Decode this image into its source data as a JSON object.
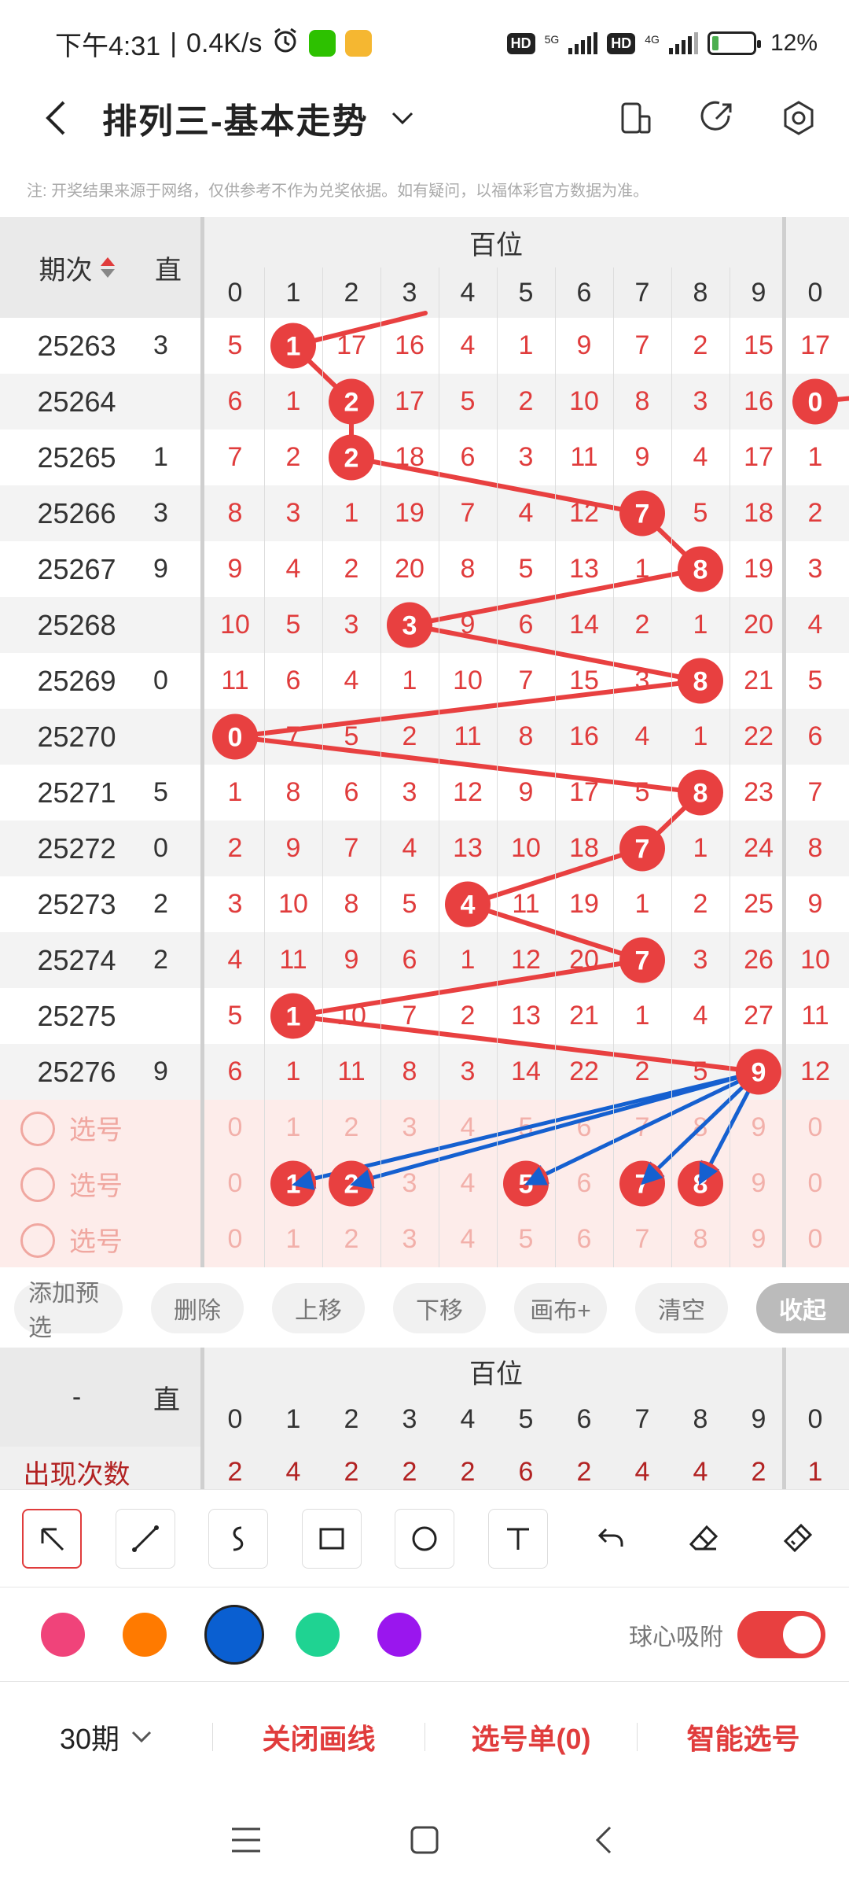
{
  "status": {
    "time": "下午4:31",
    "speed": "0.4K/s",
    "hd1": "HD",
    "net1": "5G",
    "hd2": "HD",
    "net2": "4G",
    "battery": "12%"
  },
  "header": {
    "title": "排列三-基本走势",
    "icons": [
      "back-icon",
      "dropdown-chevron-icon",
      "device-icon",
      "share-icon",
      "settings-icon"
    ]
  },
  "note": "注: 开奖结果来源于网络，仅供参考不作为兑奖依据。如有疑问，以福体彩官方数据为准。",
  "table": {
    "period_header": "期次",
    "zhi_header": "直",
    "group_header": "百位",
    "digits": [
      "0",
      "1",
      "2",
      "3",
      "4",
      "5",
      "6",
      "7",
      "8",
      "9"
    ],
    "next_digit": "0",
    "rows": [
      {
        "period": "25263",
        "zhi": "3",
        "hit": 1,
        "cells": [
          "5",
          "1",
          "17",
          "16",
          "4",
          "1",
          "9",
          "7",
          "2",
          "15"
        ],
        "next": "17"
      },
      {
        "period": "25264",
        "zhi": "",
        "hit": 2,
        "cells": [
          "6",
          "1",
          "2",
          "17",
          "5",
          "2",
          "10",
          "8",
          "3",
          "16"
        ],
        "next": "0"
      },
      {
        "period": "25265",
        "zhi": "1",
        "hit": 2,
        "cells": [
          "7",
          "2",
          "2",
          "18",
          "6",
          "3",
          "11",
          "9",
          "4",
          "17"
        ],
        "next": "1"
      },
      {
        "period": "25266",
        "zhi": "3",
        "hit": 7,
        "cells": [
          "8",
          "3",
          "1",
          "19",
          "7",
          "4",
          "12",
          "7",
          "5",
          "18"
        ],
        "next": "2"
      },
      {
        "period": "25267",
        "zhi": "9",
        "hit": 8,
        "cells": [
          "9",
          "4",
          "2",
          "20",
          "8",
          "5",
          "13",
          "1",
          "8",
          "19"
        ],
        "next": "3"
      },
      {
        "period": "25268",
        "zhi": "",
        "hit": 3,
        "cells": [
          "10",
          "5",
          "3",
          "3",
          "9",
          "6",
          "14",
          "2",
          "1",
          "20"
        ],
        "next": "4"
      },
      {
        "period": "25269",
        "zhi": "0",
        "hit": 8,
        "cells": [
          "11",
          "6",
          "4",
          "1",
          "10",
          "7",
          "15",
          "3",
          "8",
          "21"
        ],
        "next": "5"
      },
      {
        "period": "25270",
        "zhi": "",
        "hit": 0,
        "cells": [
          "0",
          "7",
          "5",
          "2",
          "11",
          "8",
          "16",
          "4",
          "1",
          "22"
        ],
        "next": "6"
      },
      {
        "period": "25271",
        "zhi": "5",
        "hit": 8,
        "cells": [
          "1",
          "8",
          "6",
          "3",
          "12",
          "9",
          "17",
          "5",
          "8",
          "23"
        ],
        "next": "7"
      },
      {
        "period": "25272",
        "zhi": "0",
        "hit": 7,
        "cells": [
          "2",
          "9",
          "7",
          "4",
          "13",
          "10",
          "18",
          "7",
          "1",
          "24"
        ],
        "next": "8"
      },
      {
        "period": "25273",
        "zhi": "2",
        "hit": 4,
        "cells": [
          "3",
          "10",
          "8",
          "5",
          "4",
          "11",
          "19",
          "1",
          "2",
          "25"
        ],
        "next": "9"
      },
      {
        "period": "25274",
        "zhi": "2",
        "hit": 7,
        "cells": [
          "4",
          "11",
          "9",
          "6",
          "1",
          "12",
          "20",
          "7",
          "3",
          "26"
        ],
        "next": "10"
      },
      {
        "period": "25275",
        "zhi": "",
        "hit": 1,
        "cells": [
          "5",
          "1",
          "10",
          "7",
          "2",
          "13",
          "21",
          "1",
          "4",
          "27"
        ],
        "next": "11"
      },
      {
        "period": "25276",
        "zhi": "9",
        "hit": 9,
        "cells": [
          "6",
          "1",
          "11",
          "8",
          "3",
          "14",
          "22",
          "2",
          "5",
          "9"
        ],
        "next": "12"
      }
    ],
    "pick_rows": [
      {
        "label": "选号",
        "selected": []
      },
      {
        "label": "选号",
        "selected": [
          1,
          2,
          5,
          7,
          8
        ]
      },
      {
        "label": "选号",
        "selected": []
      }
    ]
  },
  "actions": [
    "添加预选",
    "删除",
    "上移",
    "下移",
    "画布+",
    "清空"
  ],
  "collapse_label": "收起",
  "stats": {
    "dash": "-",
    "zhi": "直",
    "group": "百位",
    "label": "出现次数",
    "values": [
      "2",
      "4",
      "2",
      "2",
      "2",
      "6",
      "2",
      "4",
      "4",
      "2"
    ],
    "next_value": "1"
  },
  "draw_tools": [
    "cursor-arrow-icon",
    "line-icon",
    "curve-icon",
    "rectangle-icon",
    "circle-icon",
    "text-icon",
    "undo-icon",
    "eraser-icon",
    "clear-brush-icon"
  ],
  "colors": [
    "#f0437a",
    "#ff7a00",
    "#0a5fd1",
    "#1fd392",
    "#9a16ee"
  ],
  "selected_color": "#0a5fd1",
  "snap_label": "球心吸附",
  "snap_on": true,
  "bottom": {
    "period": "30期",
    "close_lines": "关闭画线",
    "pick_list": "选号单(0)",
    "smart_pick": "智能选号"
  }
}
